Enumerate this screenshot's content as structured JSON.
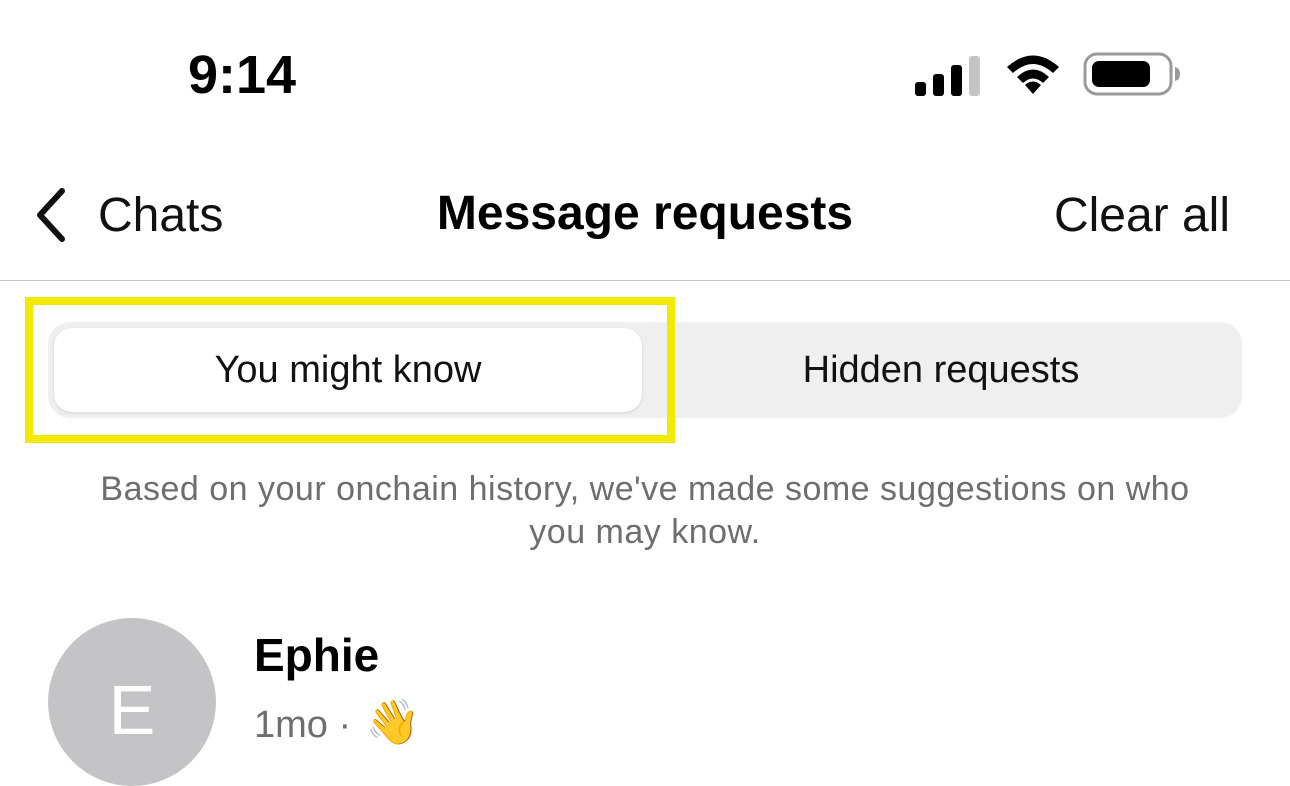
{
  "status_bar": {
    "time": "9:14"
  },
  "nav": {
    "back_label": "Chats",
    "title": "Message requests",
    "clear_all_label": "Clear all"
  },
  "tabs": [
    {
      "label": "You might know",
      "active": true
    },
    {
      "label": "Hidden requests",
      "active": false
    }
  ],
  "description": "Based on your onchain history, we've made some suggestions on who you may know.",
  "requests": [
    {
      "avatar_initial": "E",
      "name": "Ephie",
      "time": "1mo",
      "separator": "·",
      "preview": "👋"
    }
  ],
  "colors": {
    "highlight": "#f2ea05",
    "segment_bg": "#efefef",
    "secondary_text": "#6d6d72",
    "avatar_bg": "#c4c4c6"
  },
  "icons": {
    "signal": "cellular-signal-icon",
    "wifi": "wifi-icon",
    "battery": "battery-icon",
    "back": "chevron-left-icon"
  }
}
